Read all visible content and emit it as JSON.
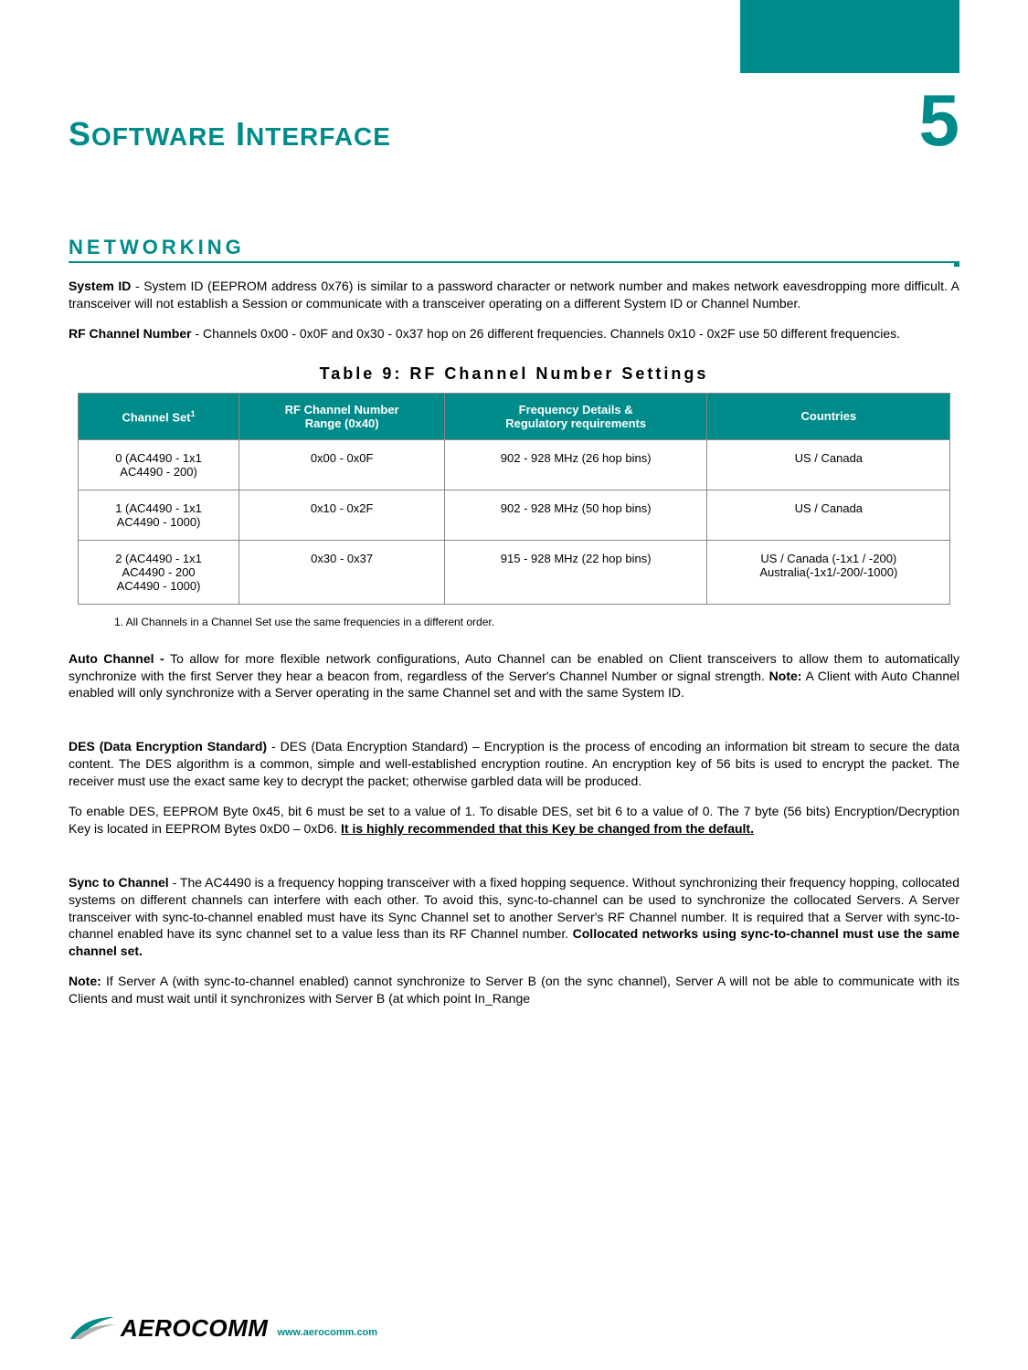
{
  "chapter": {
    "title_first_char": "S",
    "title_rest_upper": "OFTWARE",
    "title_second_first": "I",
    "title_second_rest": "NTERFACE",
    "number": "5"
  },
  "section_heading": "NETWORKING",
  "para1": {
    "bold": "System ID",
    "rest": " - System ID (EEPROM address 0x76) is similar to a password character or network number and makes network eavesdropping more difficult.  A transceiver will not establish a Session or communicate with a transceiver operating on a different System ID or Channel Number."
  },
  "para2": {
    "bold": "RF Channel Number",
    "rest": " - Channels 0x00 - 0x0F and 0x30 - 0x37 hop on 26 different frequencies.  Channels 0x10 - 0x2F use 50 different frequencies."
  },
  "table": {
    "title": "Table 9: RF Channel Number Settings",
    "headers": {
      "col1_a": "Channel Set",
      "col1_sup": "1",
      "col2_a": "RF Channel Number",
      "col2_b": "Range (0x40)",
      "col3_a": "Frequency Details &",
      "col3_b": "Regulatory requirements",
      "col4": "Countries"
    },
    "rows": [
      {
        "c1a": "0 (AC4490 - 1x1",
        "c1b": "AC4490 - 200)",
        "c2": "0x00 - 0x0F",
        "c3": "902 - 928 MHz (26 hop bins)",
        "c4a": "US / Canada",
        "c4b": ""
      },
      {
        "c1a": "1 (AC4490 - 1x1",
        "c1b": "AC4490 - 1000)",
        "c2": "0x10 - 0x2F",
        "c3": "902 - 928 MHz (50 hop bins)",
        "c4a": "US / Canada",
        "c4b": ""
      },
      {
        "c1a": "2 (AC4490 - 1x1",
        "c1b": "AC4490 - 200",
        "c1c": "AC4490 - 1000)",
        "c2": "0x30 - 0x37",
        "c3": "915 - 928 MHz (22 hop bins)",
        "c4a": "US / Canada (-1x1 / -200)",
        "c4b": "Australia(-1x1/-200/-1000)"
      }
    ],
    "footnote": "1. All Channels in a Channel Set use the same frequencies in a different order."
  },
  "para_auto": {
    "bold1": "Auto Channel - ",
    "text1": "To allow for more flexible network configurations, Auto Channel can be enabled on Client transceivers to allow them to automatically synchronize with the first Server they hear a beacon from, regardless of the Server's Channel Number or signal strength.  ",
    "bold2": "Note:",
    "text2": " A Client with Auto Channel enabled will only synchronize with a Server operating in the same Channel set and with the same System ID."
  },
  "para_des1": {
    "bold": "DES (Data Encryption Standard)",
    "rest": " - DES (Data Encryption Standard) – Encryption is the process of encoding an information bit stream to secure the data content.  The DES algorithm is a common, simple and well-established encryption routine.  An encryption key of 56 bits is used to encrypt the packet.  The receiver must use the exact same key to decrypt the packet; otherwise garbled data will be produced."
  },
  "para_des2": {
    "text1": "To enable DES, EEPROM Byte 0x45, bit 6 must be set to a value of 1.  To disable DES, set bit 6 to a value of 0.  The 7 byte (56 bits) Encryption/Decryption Key is located in EEPROM Bytes 0xD0 – 0xD6.  ",
    "under": "It is highly recommended that this Key be changed from the default."
  },
  "para_sync": {
    "bold1": "Sync to Channel",
    "text1": " - The AC4490 is a frequency hopping transceiver with a fixed hopping sequence.  Without synchronizing their frequency hopping, collocated systems on different channels can interfere with each other.  To avoid this, sync-to-channel can be used to synchronize the collocated Servers.  A Server transceiver with sync-to-channel enabled must have its Sync Channel set to another Server's RF Channel number.  It is required that a Server with sync-to-channel enabled have its sync channel set to a value less than its RF Channel number.  ",
    "bold2": "Collocated networks using sync-to-channel must use the same channel set."
  },
  "para_note": {
    "bold": "Note:",
    "rest": "  If Server A (with sync-to-channel enabled) cannot synchronize to Server B (on the sync channel), Server A will not be able to communicate with its Clients and must wait until it synchronizes with Server B (at which point In_Range"
  },
  "footer": {
    "logo": "AEROCOMM",
    "url": "www.aerocomm.com"
  }
}
